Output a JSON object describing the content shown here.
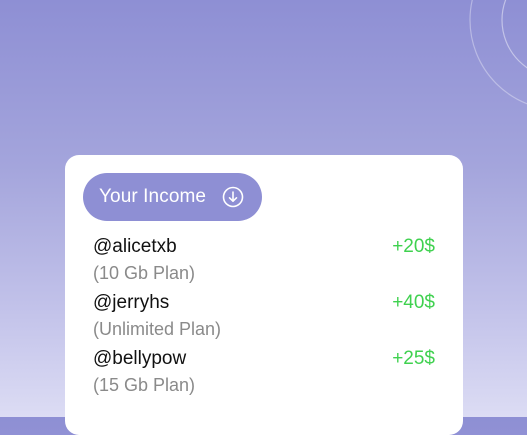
{
  "income_button": {
    "label": "Your Income",
    "icon": "arrow-down-circle-icon"
  },
  "transactions": [
    {
      "handle": "@alicetxb",
      "plan": "(10 Gb Plan)",
      "amount": "+20$"
    },
    {
      "handle": "@jerryhs",
      "plan": "(Unlimited Plan)",
      "amount": "+40$"
    },
    {
      "handle": "@bellypow",
      "plan": "(15 Gb Plan)",
      "amount": "+25$"
    }
  ],
  "colors": {
    "accent": "#8e8fd4",
    "positive_amount": "#3fd14f",
    "card": "#ffffff"
  }
}
